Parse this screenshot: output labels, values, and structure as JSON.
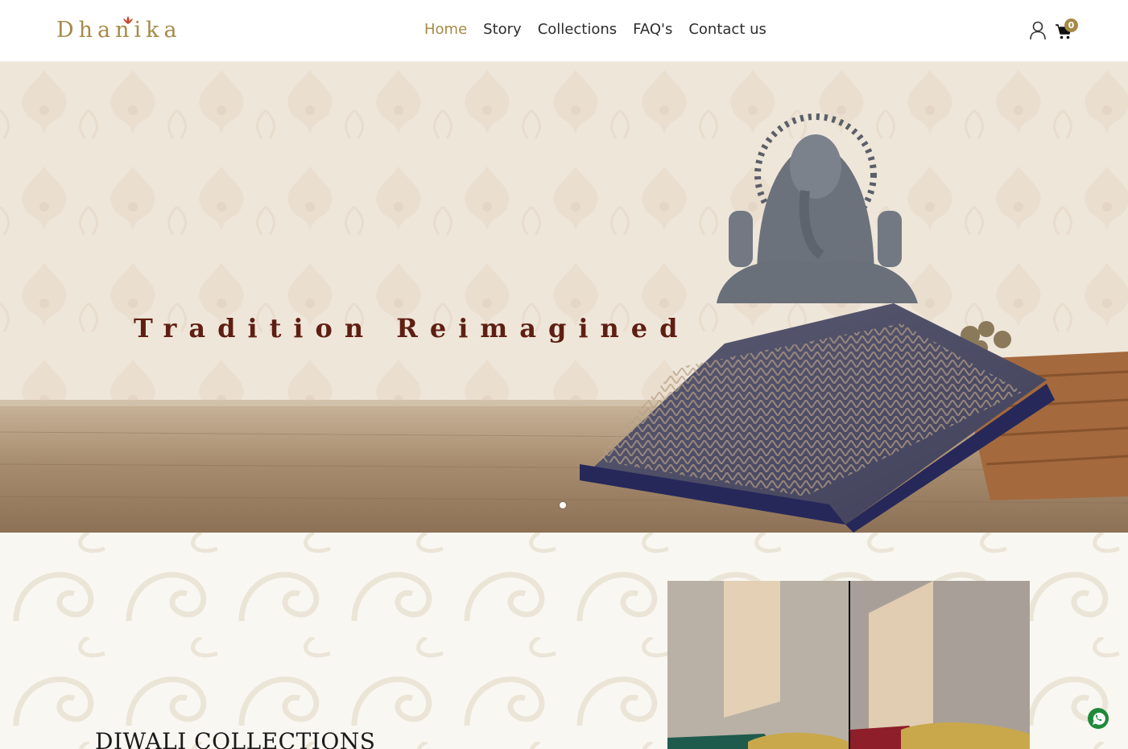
{
  "brand": {
    "name": "Dhanika"
  },
  "nav": {
    "items": [
      {
        "label": "Home",
        "active": true
      },
      {
        "label": "Story",
        "active": false
      },
      {
        "label": "Collections",
        "active": false
      },
      {
        "label": "FAQ's",
        "active": false
      },
      {
        "label": "Contact us",
        "active": false
      }
    ]
  },
  "header": {
    "user_icon": "user-icon",
    "cart_icon": "cart-icon",
    "cart_count": "0"
  },
  "hero": {
    "title": "Tradition Reimagined",
    "slide_count": 1,
    "active_slide": 1
  },
  "section": {
    "title": "DIWALI COLLECTIONS"
  },
  "colors": {
    "accent": "#a68a48",
    "hero_text": "#5e1f12",
    "whatsapp": "#1f8a3a"
  }
}
